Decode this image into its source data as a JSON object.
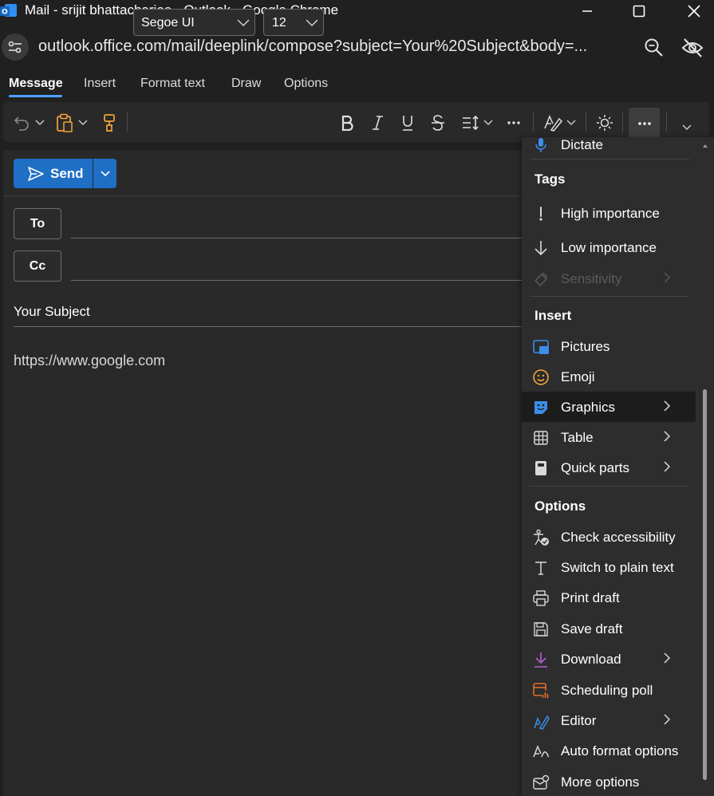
{
  "window": {
    "title": "Mail - srijit bhattacharjee - Outlook - Google Chrome"
  },
  "address_bar": {
    "url": "outlook.office.com/mail/deeplink/compose?subject=Your%20Subject&body=..."
  },
  "ribbon": {
    "tabs": [
      "Message",
      "Insert",
      "Format text",
      "Draw",
      "Options"
    ],
    "active_tab": "Message"
  },
  "toolbar": {
    "font": "Segoe UI",
    "size": "12"
  },
  "compose": {
    "send_label": "Send",
    "to_label": "To",
    "cc_label": "Cc",
    "subject": "Your Subject",
    "body": "https://www.google.com"
  },
  "menu": {
    "top_item": "Dictate",
    "sections": {
      "tags": "Tags",
      "insert": "Insert",
      "options": "Options"
    },
    "items": {
      "high_importance": "High importance",
      "low_importance": "Low importance",
      "sensitivity": "Sensitivity",
      "pictures": "Pictures",
      "emoji": "Emoji",
      "graphics": "Graphics",
      "table": "Table",
      "quick_parts": "Quick parts",
      "check_accessibility": "Check accessibility",
      "switch_plain_text": "Switch to plain text",
      "print_draft": "Print draft",
      "save_draft": "Save draft",
      "download": "Download",
      "scheduling_poll": "Scheduling poll",
      "editor": "Editor",
      "auto_format": "Auto format options",
      "more_options": "More options"
    }
  },
  "colors": {
    "accent": "#1f6fc5",
    "tab_underline": "#4ea0ff",
    "background": "#202020",
    "menu_bg": "#2d2d2d"
  }
}
